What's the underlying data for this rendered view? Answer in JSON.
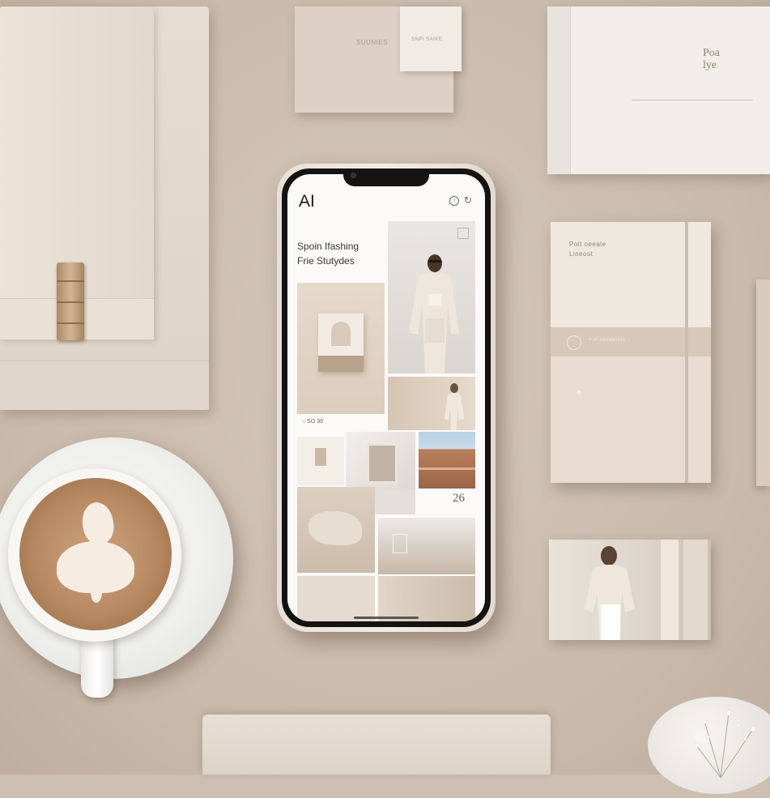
{
  "phone_app": {
    "logo": "AI",
    "heading_line1": "Spoin Ifashing",
    "heading_line2": "Frie Stutydes",
    "tile_caption": "○   SO   30",
    "tile_number": "26",
    "icons": [
      "circle-arrow-icon",
      "refresh-icon"
    ]
  },
  "props": {
    "box_text1": "SUUNIES",
    "box_text2": "SNPI SAIKE",
    "book_title_line1": "Poa",
    "book_title_line2": "lye",
    "notebook_line1": "Poit oeeale",
    "notebook_line2": "Lineost",
    "notebook_band_text": "• ol senaasate"
  },
  "colors": {
    "background": "#cdbfb2",
    "phone_screen": "#fbfaf8",
    "accent_beige": "#d7c8b9"
  }
}
